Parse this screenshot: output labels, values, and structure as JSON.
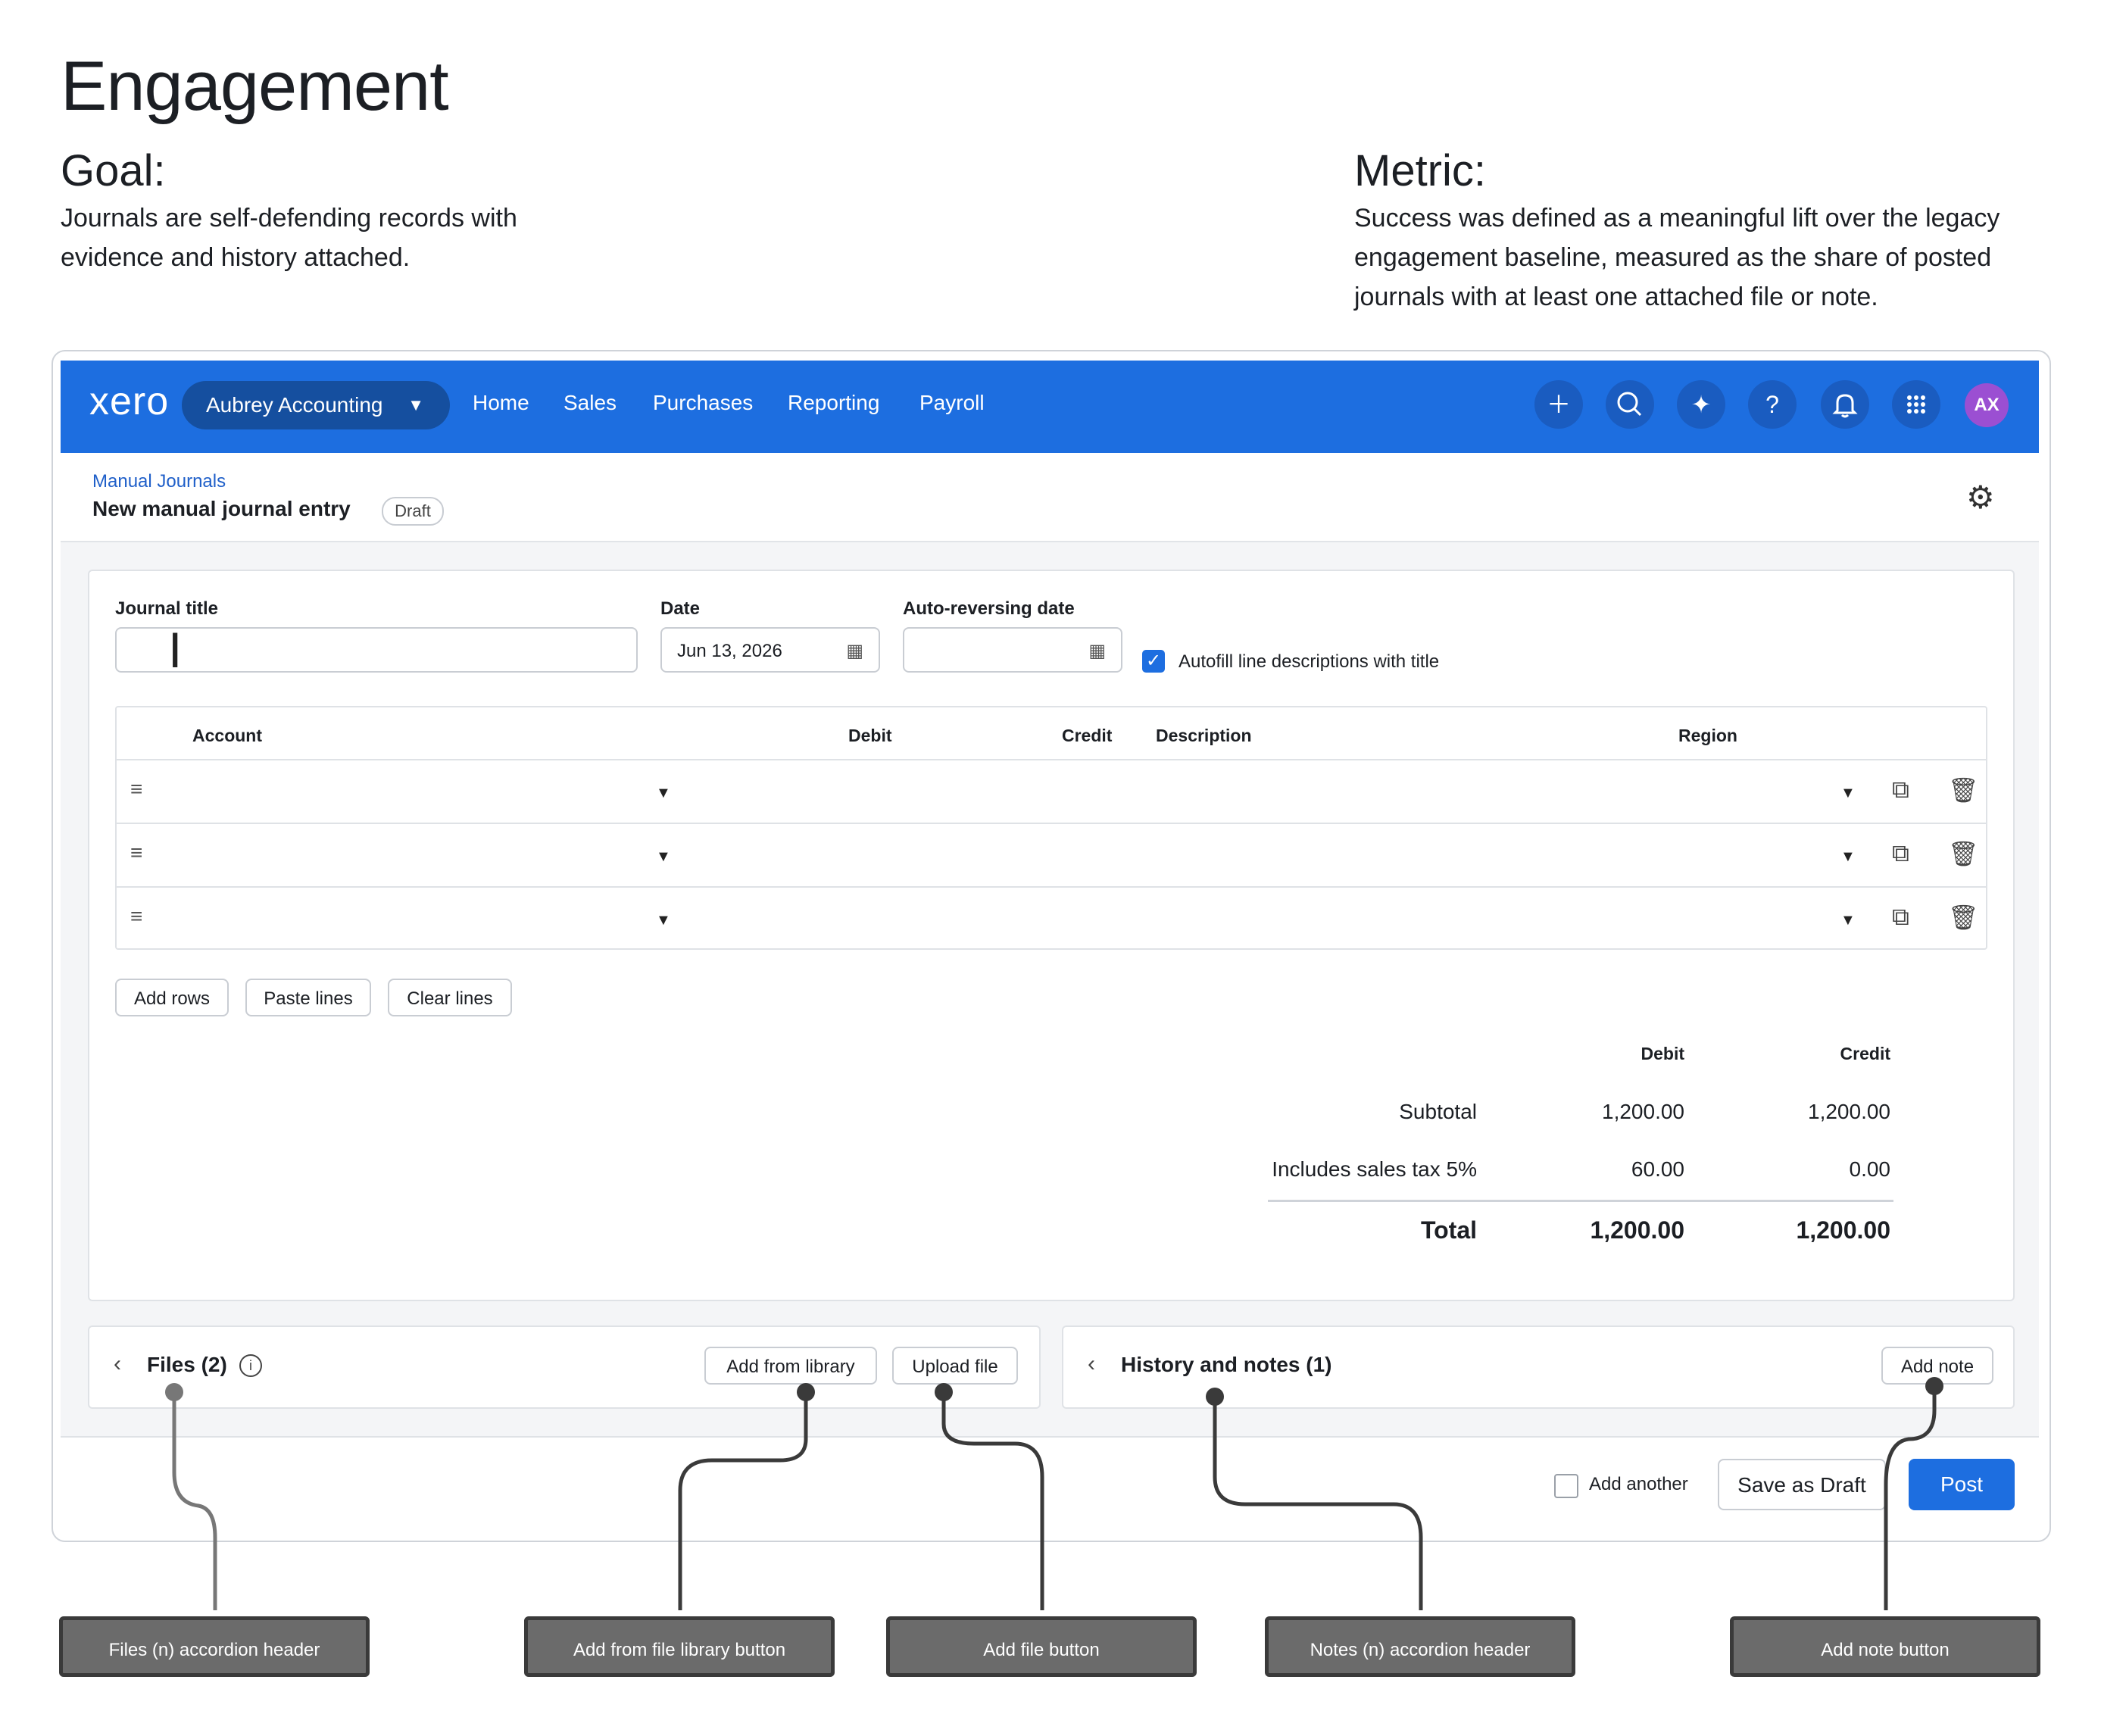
{
  "intro": {
    "title": "Engagement",
    "goal_label": "Goal:",
    "goal_text": "Journals are self-defending records with evidence and history attached.",
    "metric_label": "Metric:",
    "metric_text": "Success was defined as a meaningful lift over the legacy engagement baseline, measured as the share of posted journals with at least one attached file or note."
  },
  "appbar": {
    "logo": "xero",
    "org_name": "Aubrey Accounting",
    "nav": [
      "Home",
      "Sales",
      "Purchases",
      "Reporting",
      "Payroll"
    ],
    "icons": [
      "plus-icon",
      "search-icon",
      "sparkle-icon",
      "help-icon",
      "bell-icon",
      "apps-grid-icon"
    ],
    "avatar_initials": "AX"
  },
  "page": {
    "breadcrumb": "Manual Journals",
    "title": "New manual journal entry",
    "status": "Draft"
  },
  "form": {
    "journal_title_label": "Journal title",
    "journal_title_value": "",
    "date_label": "Date",
    "date_value": "Jun 13, 2026",
    "auto_reversing_label": "Auto-reversing date",
    "auto_reversing_value": "",
    "autofill_label": "Autofill line descriptions with title",
    "autofill_checked": true
  },
  "table": {
    "headers": {
      "account": "Account",
      "debit": "Debit",
      "credit": "Credit",
      "description": "Description",
      "region": "Region"
    },
    "row_count": 3
  },
  "line_buttons": {
    "add_rows": "Add rows",
    "paste_lines": "Paste lines",
    "clear_lines": "Clear lines"
  },
  "totals": {
    "debit_header": "Debit",
    "credit_header": "Credit",
    "subtotal_label": "Subtotal",
    "subtotal_debit": "1,200.00",
    "subtotal_credit": "1,200.00",
    "tax_label": "Includes sales tax 5%",
    "tax_debit": "60.00",
    "tax_credit": "0.00",
    "total_label": "Total",
    "total_debit": "1,200.00",
    "total_credit": "1,200.00"
  },
  "files": {
    "title": "Files (2)",
    "add_from_library": "Add from library",
    "upload": "Upload file"
  },
  "history": {
    "title": "History and notes (1)",
    "add_note": "Add note"
  },
  "footer": {
    "add_another": "Add another",
    "save_draft": "Save as Draft",
    "post": "Post"
  },
  "annotations": [
    "Files (n) accordion header",
    "Add from file library button",
    "Add file button",
    "Notes (n) accordion header",
    "Add note button"
  ],
  "colors": {
    "brand_blue": "#1d6ee0",
    "org_pill": "#154f9f",
    "avatar": "#9b4fd2",
    "annotation_bg": "#6b6b6b"
  }
}
